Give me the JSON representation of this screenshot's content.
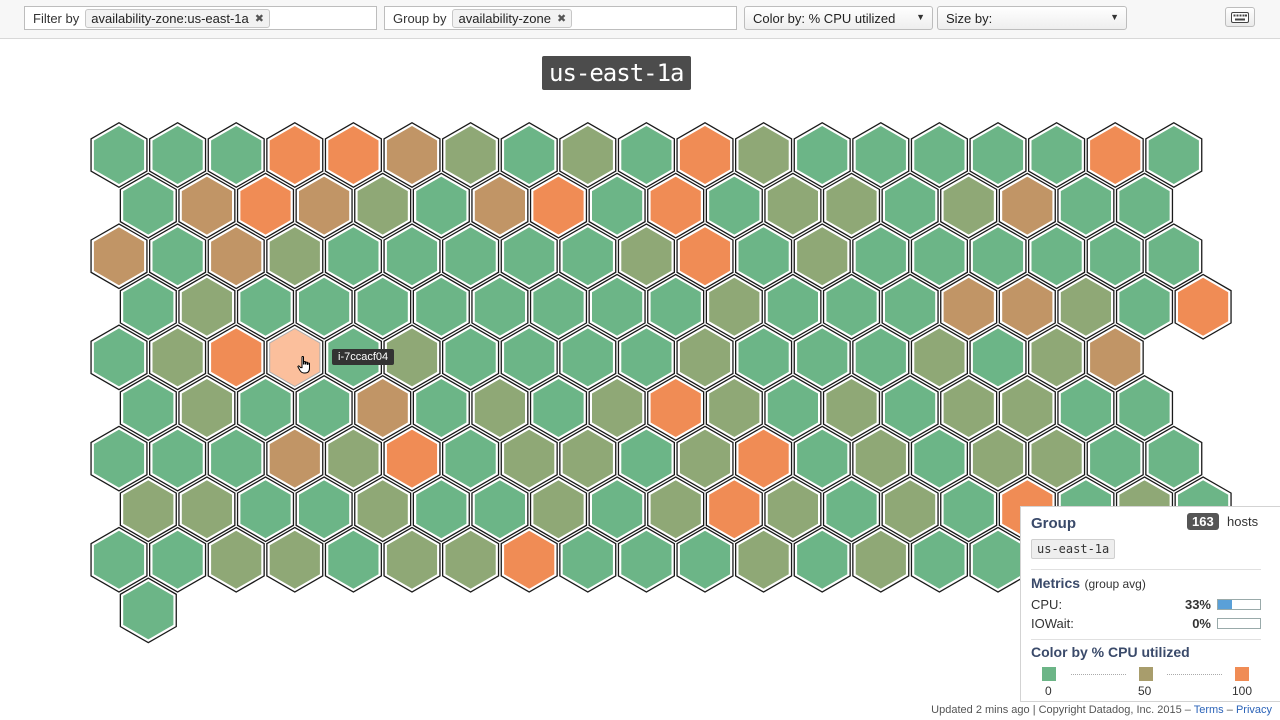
{
  "toolbar": {
    "filter_label": "Filter by",
    "filter_tag": "availability-zone:us-east-1a",
    "group_label": "Group by",
    "group_tag": "availability-zone",
    "color_select": "Color by: % CPU utilized",
    "size_select": "Size by:",
    "keyboard_icon": "keyboard-icon",
    "remove_icon": "✖"
  },
  "map": {
    "group_title": "us-east-1a",
    "tooltip": "i-7ccacf04",
    "hovered_row": 4,
    "hovered_col": 3,
    "rows": [
      "gggrrpbgbgrbgggggrg",
      "gprpbgprgrgbbgbpgg",
      "pgpbgggggbrgbgggggg",
      "gbggggggggbgggppbgr",
      "gbrpgbggggbgggbgbp",
      "gbggpgbgbrbgbgbbgg",
      "gggpbrgbbgbrgbgbbgg",
      "bbggbggbgbrbgbgrgbg",
      "ggbbgbbrgggbgbggggg",
      "g"
    ],
    "colors": {
      "g": "#6cb587",
      "b": "#8fa876",
      "p": "#c19566",
      "r": "#f08c55",
      "highlight": "#fbbf9c"
    }
  },
  "panel": {
    "group_heading": "Group",
    "host_count": "163",
    "hosts_label": "hosts",
    "group_value": "us-east-1a",
    "metrics_heading": "Metrics",
    "metrics_sub": "(group avg)",
    "metrics": [
      {
        "name": "CPU:",
        "value": "33%",
        "fill": 0.33
      },
      {
        "name": "IOWait:",
        "value": "0%",
        "fill": 0.0
      }
    ],
    "color_heading": "Color by % CPU utilized",
    "legend": [
      {
        "label": "0",
        "color": "#6cb587"
      },
      {
        "label": "50",
        "color": "#a89d6c"
      },
      {
        "label": "100",
        "color": "#f08c55"
      }
    ]
  },
  "footer": {
    "updated": "Updated 2 mins ago",
    "sep": "|",
    "copyright": "Copyright Datadog, Inc. 2015 –",
    "terms": "Terms",
    "dash": "–",
    "privacy": "Privacy"
  }
}
